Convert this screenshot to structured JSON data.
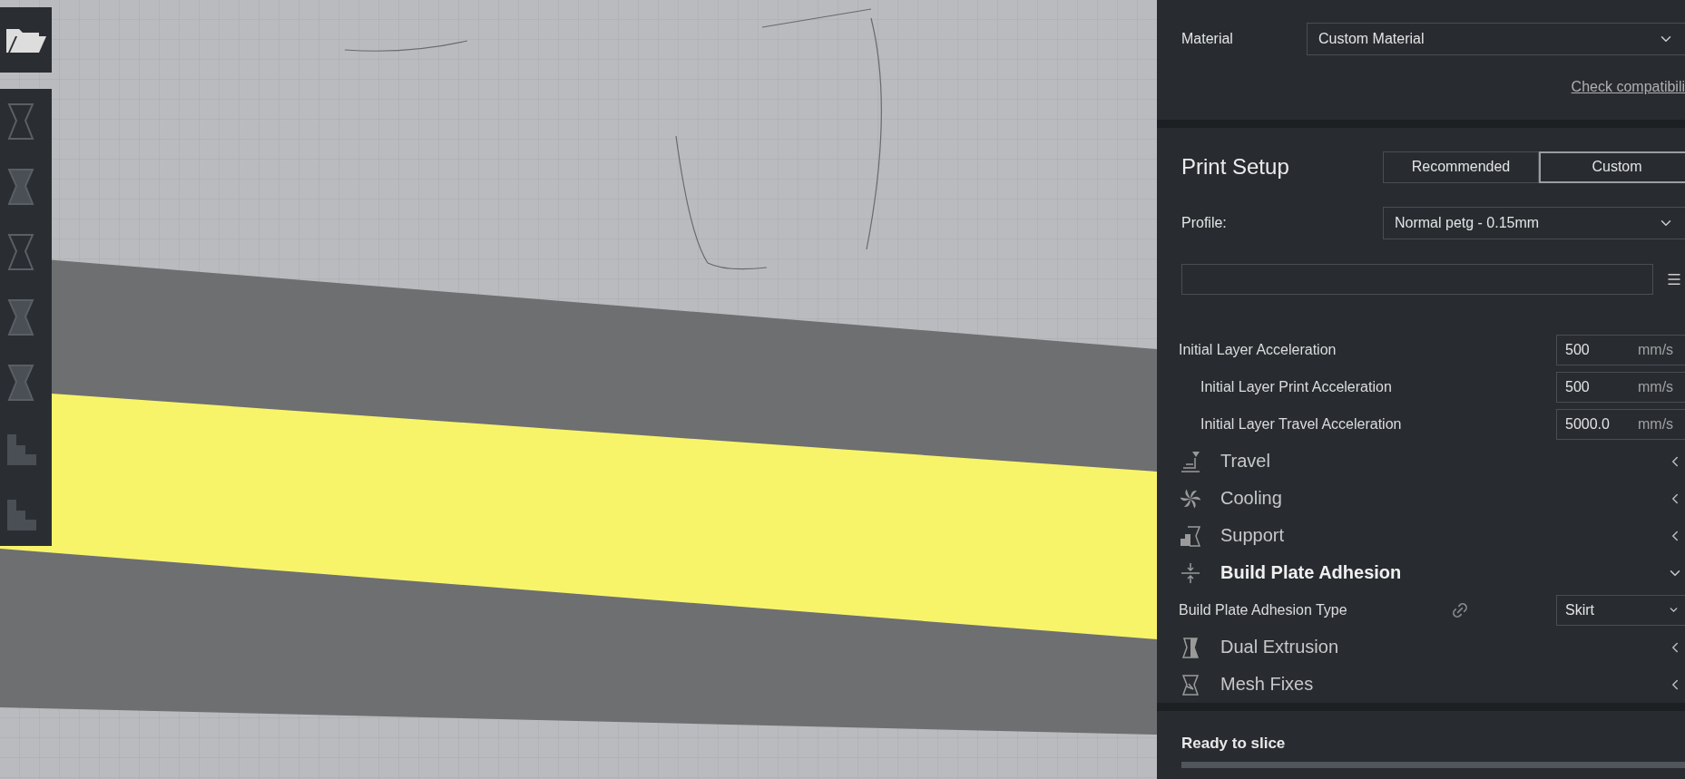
{
  "material": {
    "label": "Material",
    "value": "Custom Material",
    "link": "Check compatibili"
  },
  "print_setup": {
    "title": "Print Setup",
    "tabs": [
      {
        "label": "Recommended",
        "selected": false
      },
      {
        "label": "Custom",
        "selected": true
      }
    ],
    "profile": {
      "label": "Profile:",
      "value": "Normal petg - 0.15mm"
    },
    "settings": [
      {
        "kind": "setting",
        "label": "Initial Layer Acceleration",
        "value": "500",
        "unit": "mm/s",
        "children": [
          {
            "kind": "setting",
            "label": "Initial Layer Print Acceleration",
            "value": "500",
            "unit": "mm/s"
          },
          {
            "kind": "setting",
            "label": "Initial Layer Travel Acceleration",
            "value": "5000.0",
            "unit": "mm/s"
          }
        ]
      },
      {
        "kind": "category",
        "label": "Travel",
        "expanded": false
      },
      {
        "kind": "category",
        "label": "Cooling",
        "expanded": false
      },
      {
        "kind": "category",
        "label": "Support",
        "expanded": false
      },
      {
        "kind": "category",
        "label": "Build Plate Adhesion",
        "expanded": true,
        "children": [
          {
            "kind": "dropdown",
            "label": "Build Plate Adhesion Type",
            "value": "Skirt",
            "linked": true
          }
        ]
      },
      {
        "kind": "category",
        "label": "Dual Extrusion",
        "expanded": false
      },
      {
        "kind": "category",
        "label": "Mesh Fixes",
        "expanded": false
      }
    ]
  },
  "status": {
    "text": "Ready to slice",
    "level": 0
  }
}
